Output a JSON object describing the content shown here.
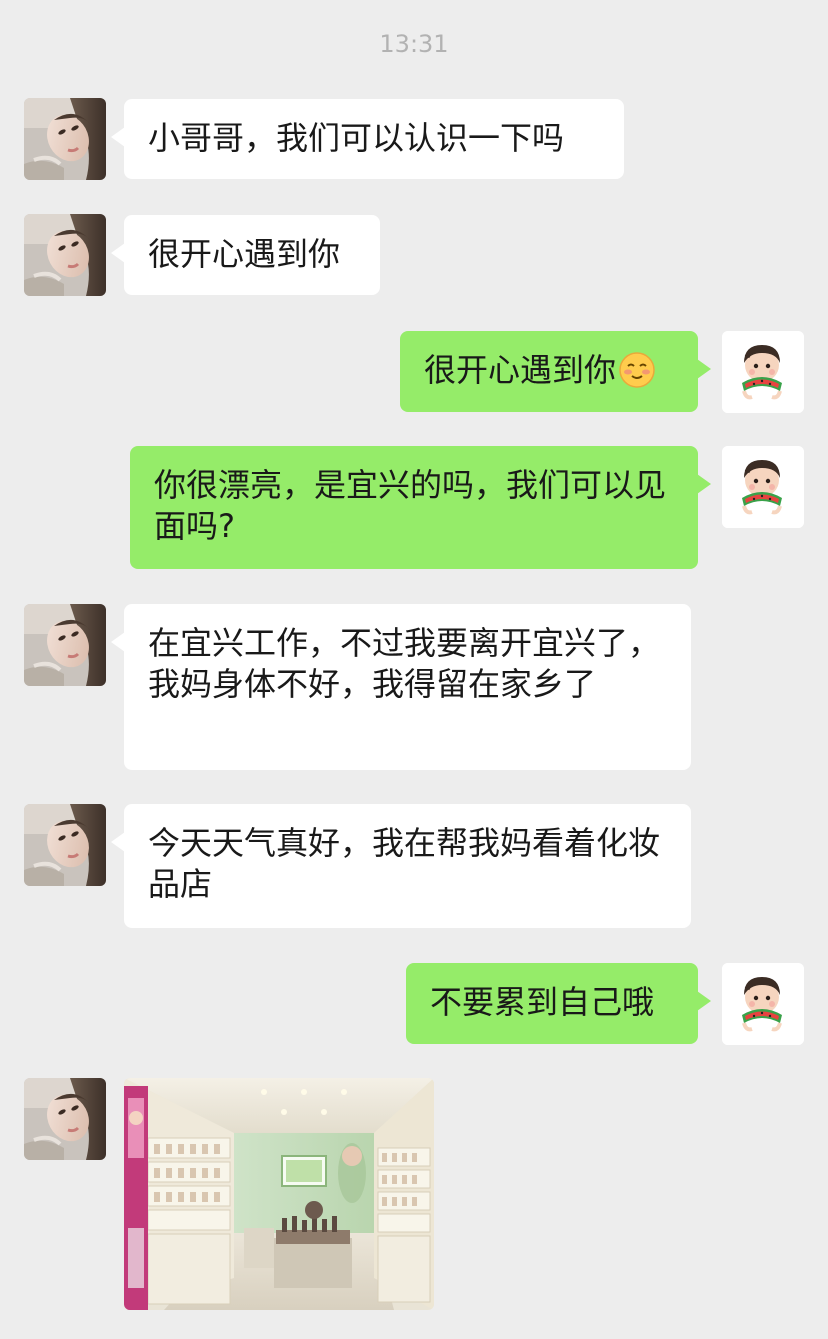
{
  "chat": {
    "timestamp": "13:31",
    "messages": [
      {
        "sender": "contact",
        "type": "text",
        "text": "小哥哥，我们可以认识一下吗"
      },
      {
        "sender": "contact",
        "type": "text",
        "text": "很开心遇到你"
      },
      {
        "sender": "me",
        "type": "text",
        "text": "很开心遇到你",
        "emoji": "blushing-smile-emoji"
      },
      {
        "sender": "me",
        "type": "text",
        "text": "你很漂亮，是宜兴的吗，我们可以见面吗?"
      },
      {
        "sender": "contact",
        "type": "text",
        "text": "在宜兴工作，不过我要离开宜兴了，我妈身体不好，我得留在家乡了"
      },
      {
        "sender": "contact",
        "type": "text",
        "text": "今天天气真好，我在帮我妈看着化妆品店"
      },
      {
        "sender": "me",
        "type": "text",
        "text": "不要累到自己哦"
      },
      {
        "sender": "contact",
        "type": "image",
        "subject": "cosmetics-shop-photo"
      }
    ]
  },
  "colors": {
    "background": "#ededed",
    "incoming_bubble": "#ffffff",
    "outgoing_bubble": "#95ec69",
    "text": "#191919",
    "timestamp": "#b2b2b2"
  },
  "icons": {
    "contact_avatar": "contact-avatar-photo",
    "my_avatar": "watermelon-kid-avatar",
    "emoji": "blushing-smile-emoji"
  }
}
